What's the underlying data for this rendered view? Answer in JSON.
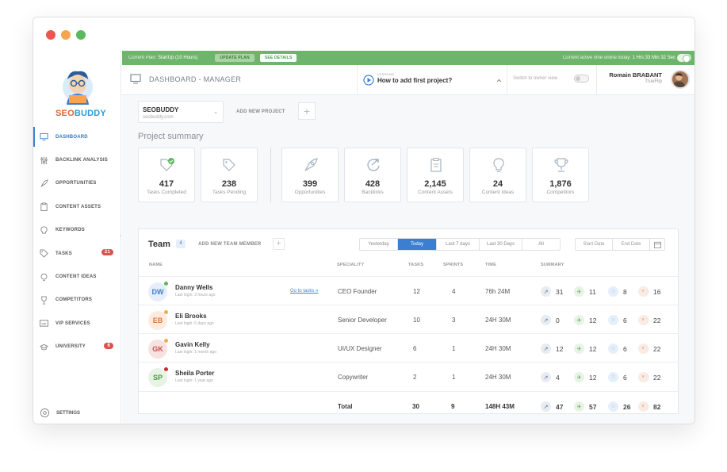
{
  "window": {
    "dot_colors": [
      "#f0544f",
      "#f5a54d",
      "#5cb85c"
    ]
  },
  "brand": {
    "part1": "SEO",
    "part2": "BUDDY"
  },
  "sidebar": {
    "items": [
      {
        "label": "DASHBOARD",
        "icon": "monitor-icon",
        "active": true
      },
      {
        "label": "BACKLINK ANALYSIS",
        "icon": "sliders-icon"
      },
      {
        "label": "OPPORTUNITIES",
        "icon": "rocket-icon"
      },
      {
        "label": "CONTENT ASSETS",
        "icon": "clipboard-icon"
      },
      {
        "label": "KEYWORDS",
        "icon": "bulb-icon"
      },
      {
        "label": "TASKS",
        "icon": "tag-icon",
        "badge": "21"
      },
      {
        "label": "CONTENT IDEAS",
        "icon": "lightbulb-icon"
      },
      {
        "label": "COMPETITORS",
        "icon": "trophy-icon"
      },
      {
        "label": "VIP SERVICES",
        "icon": "vip-icon"
      },
      {
        "label": "UNIVERSITY",
        "icon": "graduation-cap-icon",
        "badge": "6"
      }
    ],
    "settings": "SETTINGS"
  },
  "topbar": {
    "plan_label": "Current Plan:",
    "plan_value": "StartUp (10 Hours)",
    "update_plan": "UPDATE PLAN",
    "see_details": "SEE DETAILS",
    "active_label": "Current active time online today:",
    "active_value": "1 Hrs 33 Min 32 Sec"
  },
  "header": {
    "title": "DASHBOARD - MANAGER",
    "lesson_small": "LESSONS",
    "lesson_title": "How to add first project?",
    "owner_view": "Switch to owner view",
    "user_name": "Romain BRABANT",
    "user_company": "TrueFlip"
  },
  "project": {
    "name": "SEOBUDDY",
    "url": "seobuddy.com",
    "add_new": "ADD NEW PROJECT"
  },
  "summary": {
    "title": "Project summary",
    "cards": [
      {
        "value": "417",
        "label": "Tasks Completed"
      },
      {
        "value": "238",
        "label": "Tasks Pending"
      },
      {
        "value": "399",
        "label": "Opportunities"
      },
      {
        "value": "428",
        "label": "Backlinks"
      },
      {
        "value": "2,145",
        "label": "Content Assets"
      },
      {
        "value": "24",
        "label": "Content Ideas"
      },
      {
        "value": "1,876",
        "label": "Competitors"
      }
    ]
  },
  "team": {
    "title": "Team",
    "count": "4",
    "add_member": "ADD NEW TEAM MEMBER",
    "filters": [
      "Yesterday",
      "Today",
      "Last 7 days",
      "Last 30 Days",
      "All"
    ],
    "start_date": "Start Date",
    "end_date": "End Date",
    "columns": [
      "NAME",
      "SPECIALITY",
      "TASKS",
      "SPRINTS",
      "TIME",
      "SUMMARY"
    ],
    "goto": "Go to tasks »",
    "members": [
      {
        "initials": "DW",
        "name": "Danny Wells",
        "login": "Last login: 3 hours ago",
        "speciality": "CEO Founder",
        "tasks": "12",
        "sprints": "4",
        "time": "76h 24M",
        "s1": "31",
        "s2": "11",
        "s3": "8",
        "s4": "16",
        "bg": "#e7eef9",
        "fg": "#3c7fd0",
        "status": "#5cb85c"
      },
      {
        "initials": "EB",
        "name": "Eli Brooks",
        "login": "Last login: 6 days ago",
        "speciality": "Senior Developer",
        "tasks": "10",
        "sprints": "3",
        "time": "24H 30M",
        "s1": "0",
        "s2": "12",
        "s3": "6",
        "s4": "22",
        "bg": "#fdebe0",
        "fg": "#e0773f",
        "status": "#f0ad4e"
      },
      {
        "initials": "GK",
        "name": "Gavin Kelly",
        "login": "Last login: 1 month ago",
        "speciality": "UI/UX Designer",
        "tasks": "6",
        "sprints": "1",
        "time": "24H 30M",
        "s1": "12",
        "s2": "12",
        "s3": "6",
        "s4": "22",
        "bg": "#f7e1e1",
        "fg": "#c9514d",
        "status": "#f0ad4e"
      },
      {
        "initials": "SP",
        "name": "Sheila Porter",
        "login": "Last login: 1 year ago",
        "speciality": "Copywriter",
        "tasks": "2",
        "sprints": "1",
        "time": "24H 30M",
        "s1": "4",
        "s2": "12",
        "s3": "6",
        "s4": "22",
        "bg": "#e6f3e5",
        "fg": "#4d9a49",
        "status": "#c9302c"
      }
    ],
    "total": {
      "label": "Total",
      "tasks": "30",
      "sprints": "9",
      "time": "148H 43M",
      "s1": "47",
      "s2": "57",
      "s3": "26",
      "s4": "82"
    }
  }
}
